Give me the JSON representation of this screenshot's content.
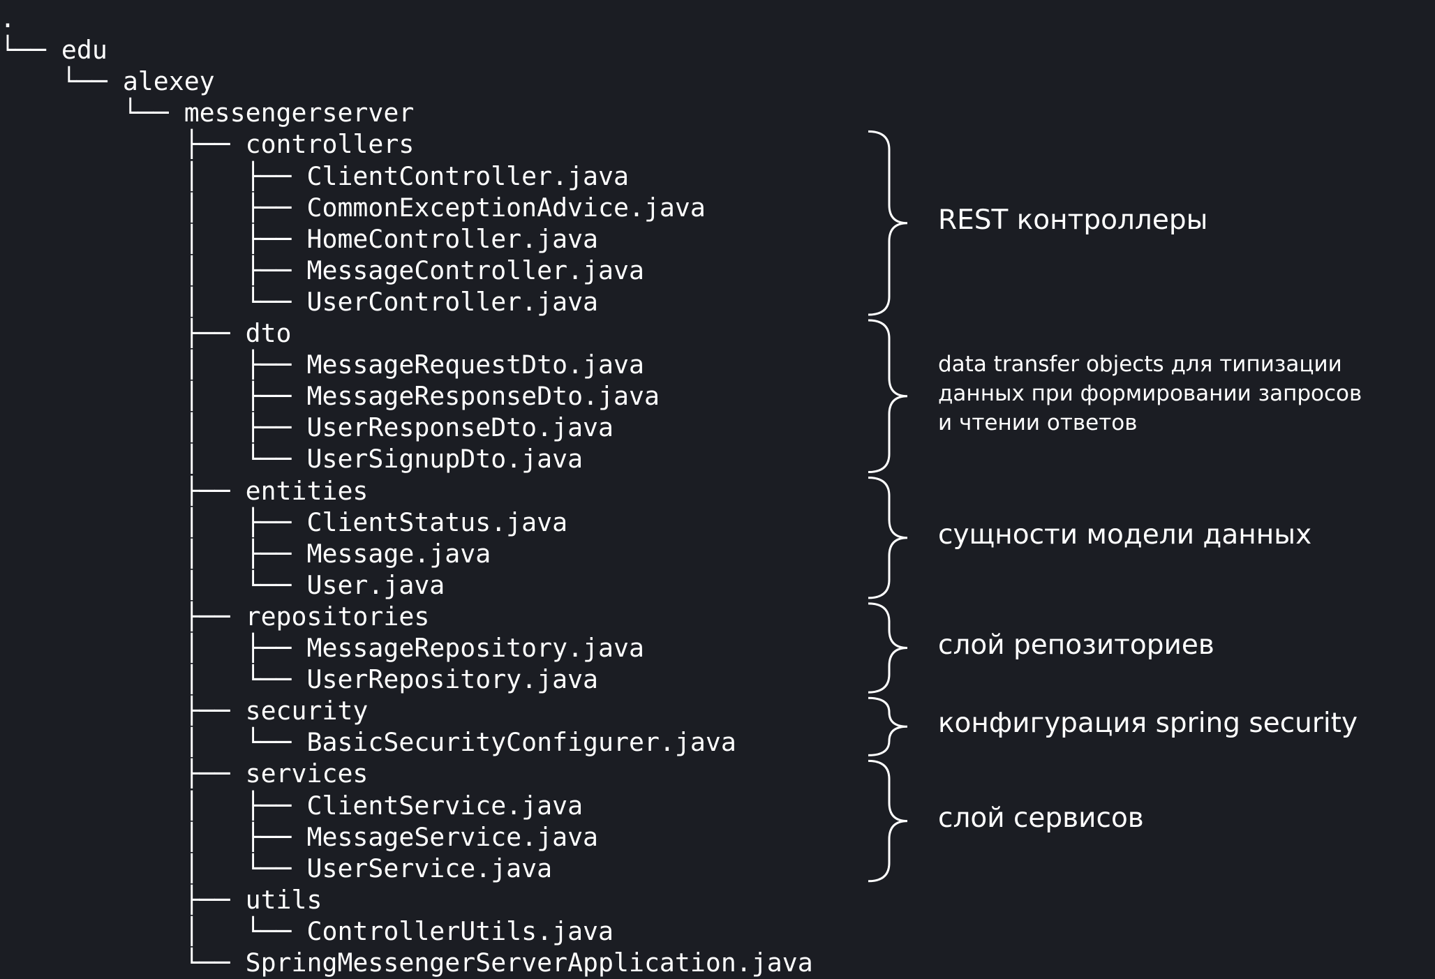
{
  "tree": {
    "rows": [
      {
        "prefix": ".",
        "name": ""
      },
      {
        "prefix": "└── ",
        "name": "edu"
      },
      {
        "prefix": "    └── ",
        "name": "alexey"
      },
      {
        "prefix": "        └── ",
        "name": "messengerserver"
      },
      {
        "prefix": "            ├── ",
        "name": "controllers"
      },
      {
        "prefix": "            │   ├── ",
        "name": "ClientController.java"
      },
      {
        "prefix": "            │   ├── ",
        "name": "CommonExceptionAdvice.java"
      },
      {
        "prefix": "            │   ├── ",
        "name": "HomeController.java"
      },
      {
        "prefix": "            │   ├── ",
        "name": "MessageController.java"
      },
      {
        "prefix": "            │   └── ",
        "name": "UserController.java"
      },
      {
        "prefix": "            ├── ",
        "name": "dto"
      },
      {
        "prefix": "            │   ├── ",
        "name": "MessageRequestDto.java"
      },
      {
        "prefix": "            │   ├── ",
        "name": "MessageResponseDto.java"
      },
      {
        "prefix": "            │   ├── ",
        "name": "UserResponseDto.java"
      },
      {
        "prefix": "            │   └── ",
        "name": "UserSignupDto.java"
      },
      {
        "prefix": "            ├── ",
        "name": "entities"
      },
      {
        "prefix": "            │   ├── ",
        "name": "ClientStatus.java"
      },
      {
        "prefix": "            │   ├── ",
        "name": "Message.java"
      },
      {
        "prefix": "            │   └── ",
        "name": "User.java"
      },
      {
        "prefix": "            ├── ",
        "name": "repositories"
      },
      {
        "prefix": "            │   ├── ",
        "name": "MessageRepository.java"
      },
      {
        "prefix": "            │   └── ",
        "name": "UserRepository.java"
      },
      {
        "prefix": "            ├── ",
        "name": "security"
      },
      {
        "prefix": "            │   └── ",
        "name": "BasicSecurityConfigurer.java"
      },
      {
        "prefix": "            ├── ",
        "name": "services"
      },
      {
        "prefix": "            │   ├── ",
        "name": "ClientService.java"
      },
      {
        "prefix": "            │   ├── ",
        "name": "MessageService.java"
      },
      {
        "prefix": "            │   └── ",
        "name": "UserService.java"
      },
      {
        "prefix": "            ├── ",
        "name": "utils"
      },
      {
        "prefix": "            │   └── ",
        "name": "ControllerUtils.java"
      },
      {
        "prefix": "            └── ",
        "name": "SpringMessengerServerApplication.java"
      }
    ]
  },
  "annotations": [
    {
      "from_row": 4,
      "to_row": 9,
      "size": "big",
      "lines": [
        "REST контроллеры"
      ]
    },
    {
      "from_row": 10,
      "to_row": 14,
      "size": "small",
      "lines": [
        "data transfer objects для типизации",
        "данных при формировании запросов",
        "и чтении ответов"
      ]
    },
    {
      "from_row": 15,
      "to_row": 18,
      "size": "big",
      "lines": [
        "сущности модели данных"
      ]
    },
    {
      "from_row": 19,
      "to_row": 21,
      "size": "big",
      "lines": [
        "слой репозиториев"
      ]
    },
    {
      "from_row": 22,
      "to_row": 23,
      "size": "big",
      "lines": [
        "конфигурация spring security"
      ]
    },
    {
      "from_row": 24,
      "to_row": 27,
      "size": "big",
      "lines": [
        "слой сервисов"
      ]
    }
  ],
  "colors": {
    "background": "#1b1d23",
    "text": "#ffffff"
  }
}
